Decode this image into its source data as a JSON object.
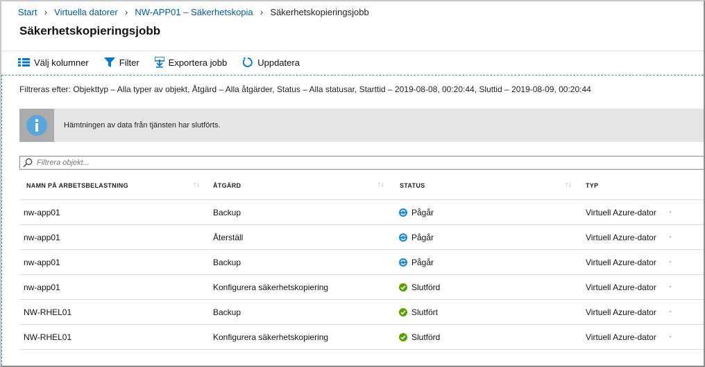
{
  "breadcrumb": {
    "items": [
      "Start",
      "Virtuella datorer",
      "NW-APP01 – Säkerhetskopia"
    ],
    "current": "Säkerhetskopieringsjobb"
  },
  "page": {
    "title": "Säkerhetskopieringsjobb"
  },
  "toolbar": {
    "choose_columns": "Välj kolumner",
    "filter": "Filter",
    "export": "Exportera jobb",
    "refresh": "Uppdatera"
  },
  "filter_text": "Filtreras efter: Objekttyp – Alla typer av objekt, Åtgärd – Alla åtgärder, Status – Alla statusar, Starttid – 2019-08-08, 00:20:44, Sluttid – 2019-08-09, 00:20:44",
  "info": {
    "message": "Hämtningen av data från tjänsten har slutförts.",
    "icon": "info-icon"
  },
  "search": {
    "placeholder": "Filtrera objekt..."
  },
  "table": {
    "headers": [
      "NAMN PÅ ARBETSBELASTNING",
      "ÅTGÄRD",
      "STATUS",
      "TYP"
    ],
    "rows": [
      {
        "name": "nw-app01",
        "action": "Backup",
        "status": "Pågår",
        "status_icon": "in-progress-icon",
        "type": "Virtuell Azure-dator"
      },
      {
        "name": "nw-app01",
        "action": "Återställ",
        "status": "Pågår",
        "status_icon": "in-progress-icon",
        "type": "Virtuell Azure-dator"
      },
      {
        "name": "nw-app01",
        "action": "Backup",
        "status": "Pågår",
        "status_icon": "in-progress-icon",
        "type": "Virtuell Azure-dator"
      },
      {
        "name": "nw-app01",
        "action": "Konfigurera säkerhetskopiering",
        "status": "Slutförd",
        "status_icon": "completed-icon",
        "type": "Virtuell Azure-dator"
      },
      {
        "name": "NW-RHEL01",
        "action": "Backup",
        "status": "Slutfört",
        "status_icon": "completed-icon",
        "type": "Virtuell Azure-dator"
      },
      {
        "name": "NW-RHEL01",
        "action": "Konfigurera säkerhetskopiering",
        "status": "Slutförd",
        "status_icon": "completed-icon",
        "type": "Virtuell Azure-dator"
      }
    ]
  },
  "colors": {
    "link": "#0058ad",
    "accent": "#0078d4",
    "success": "#57a300",
    "info_bar": "#e5e5e5"
  }
}
